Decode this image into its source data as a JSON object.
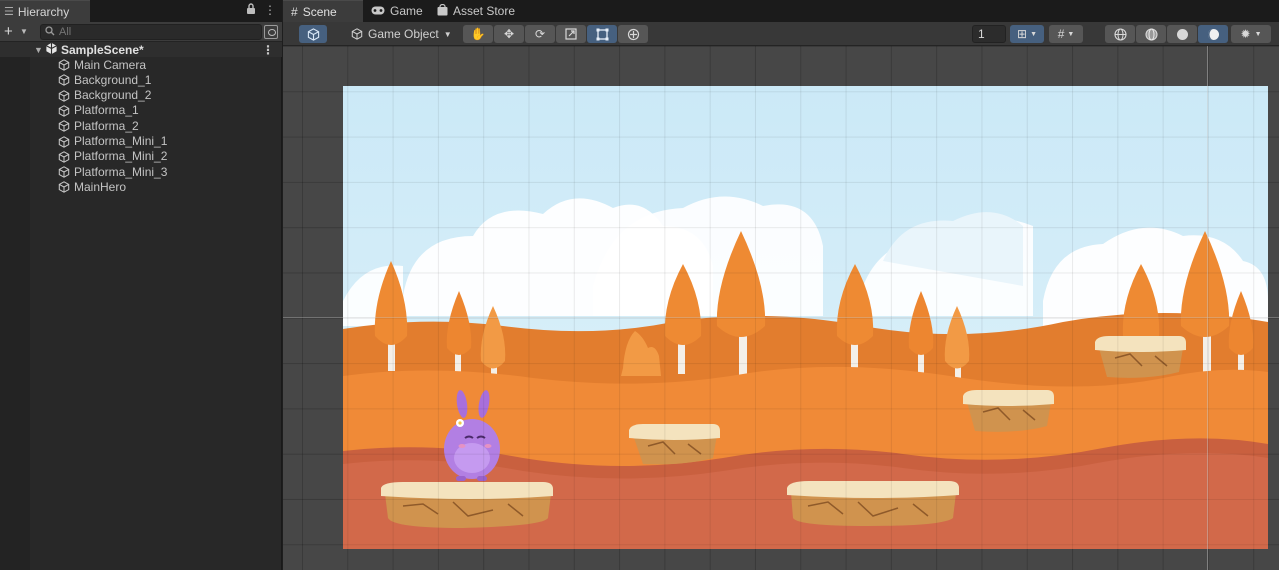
{
  "hierarchy": {
    "tab_label": "Hierarchy",
    "search_placeholder": "All",
    "scene_name": "SampleScene*",
    "items": [
      {
        "label": "Main Camera"
      },
      {
        "label": "Background_1"
      },
      {
        "label": "Background_2"
      },
      {
        "label": "Platforma_1"
      },
      {
        "label": "Platforma_2"
      },
      {
        "label": "Platforma_Mini_1"
      },
      {
        "label": "Platforma_Mini_2"
      },
      {
        "label": "Platforma_Mini_3"
      },
      {
        "label": "MainHero"
      }
    ]
  },
  "scene_tabs": {
    "scene": "Scene",
    "game": "Game",
    "asset_store": "Asset Store"
  },
  "scene_toolbar": {
    "tool_context": "Game Object",
    "grid_size": "1"
  },
  "colors": {
    "selected_tool": "#46607f",
    "sky": "#cbe9f6",
    "orange_trees": "#ee8a33",
    "ground_front": "#d2694a"
  }
}
